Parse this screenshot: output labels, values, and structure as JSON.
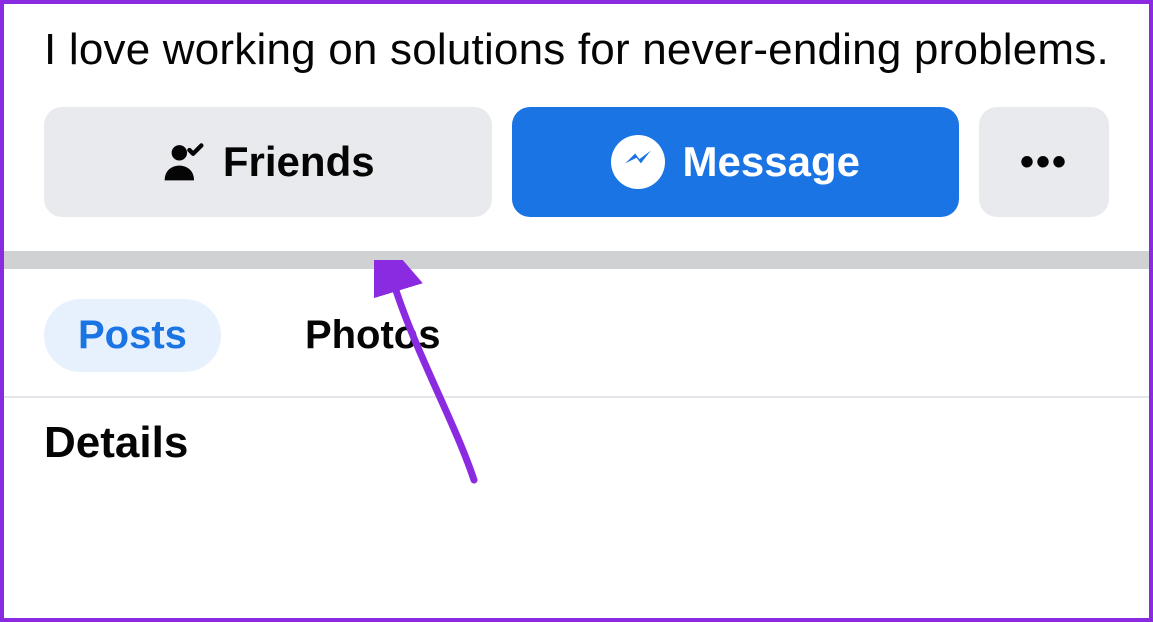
{
  "bio": "I love working on solutions for never-ending problems.",
  "buttons": {
    "friends": "Friends",
    "message": "Message",
    "more": "•••"
  },
  "tabs": {
    "posts": "Posts",
    "photos": "Photos",
    "active": "posts"
  },
  "section": {
    "details": "Details"
  },
  "colors": {
    "primary": "#1B74E4",
    "secondary_bg": "#E8EAED",
    "active_tab_bg": "#E7F0FD",
    "annotation": "#8A2BE2"
  }
}
